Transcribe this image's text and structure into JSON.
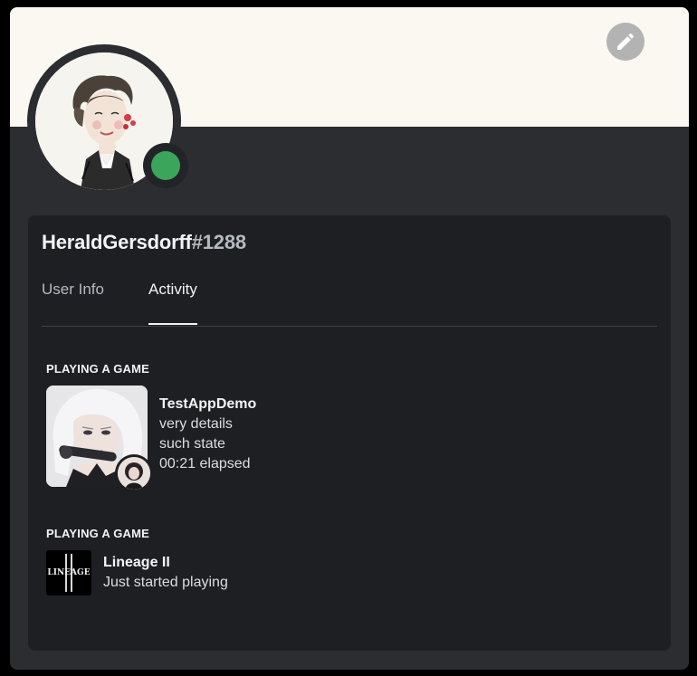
{
  "profile": {
    "username": "HeraldGersdorff",
    "discriminator": "#1288",
    "status": "online",
    "banner_color": "#faf8f1",
    "status_color": "#3ba55c"
  },
  "header": {
    "edit_icon": "pencil-icon"
  },
  "tabs": [
    {
      "label": "User Info",
      "active": false
    },
    {
      "label": "Activity",
      "active": true
    }
  ],
  "activities": [
    {
      "section_title": "PLAYING A GAME",
      "name": "TestAppDemo",
      "details": "very details",
      "state": "such state",
      "elapsed": "00:21 elapsed"
    },
    {
      "section_title": "PLAYING A GAME",
      "name": "Lineage II",
      "state": "Just started playing",
      "logo_text": "LINEAGE"
    }
  ]
}
